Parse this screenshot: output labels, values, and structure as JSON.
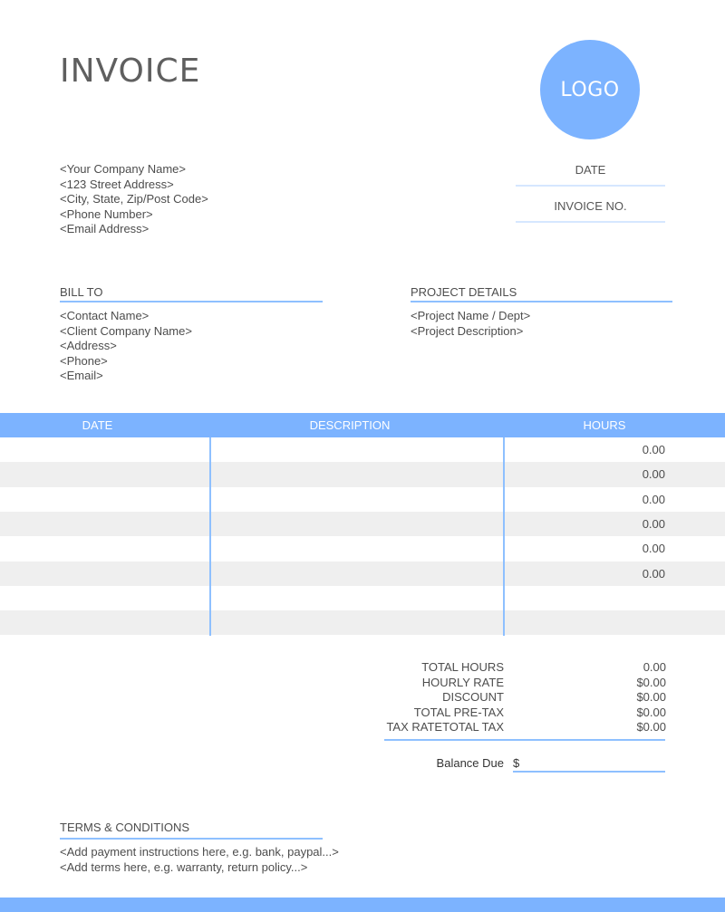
{
  "header": {
    "title": "INVOICE",
    "logo_text": "LOGO"
  },
  "company": {
    "lines": [
      "<Your Company Name>",
      "<123 Street Address>",
      "<City, State, Zip/Post Code>",
      "<Phone Number>",
      "<Email Address>"
    ]
  },
  "meta": {
    "date_label": "DATE",
    "invoice_no_label": "INVOICE NO."
  },
  "bill_to": {
    "heading": "BILL TO",
    "lines": [
      "<Contact Name>",
      "<Client Company Name>",
      "<Address>",
      "<Phone>",
      "<Email>"
    ]
  },
  "project": {
    "heading": "PROJECT DETAILS",
    "lines": [
      "<Project Name / Dept>",
      "<Project Description>"
    ]
  },
  "table": {
    "columns": [
      "DATE",
      "DESCRIPTION",
      "HOURS"
    ],
    "rows": [
      {
        "date": "",
        "description": "",
        "hours": "0.00"
      },
      {
        "date": "",
        "description": "",
        "hours": "0.00"
      },
      {
        "date": "",
        "description": "",
        "hours": "0.00"
      },
      {
        "date": "",
        "description": "",
        "hours": "0.00"
      },
      {
        "date": "",
        "description": "",
        "hours": "0.00"
      },
      {
        "date": "",
        "description": "",
        "hours": "0.00"
      },
      {
        "date": "",
        "description": "",
        "hours": ""
      },
      {
        "date": "",
        "description": "",
        "hours": ""
      }
    ]
  },
  "totals": {
    "labels": [
      "TOTAL HOURS",
      "HOURLY RATE",
      "DISCOUNT",
      "TOTAL PRE-TAX",
      "TAX RATETOTAL TAX"
    ],
    "values": [
      "0.00",
      "$0.00",
      "$0.00",
      "$0.00",
      "$0.00"
    ],
    "balance_label": "Balance Due",
    "balance_currency": "$"
  },
  "terms": {
    "heading": "TERMS & CONDITIONS",
    "lines": [
      "<Add payment instructions here, e.g. bank, paypal...>",
      "<Add terms here, e.g. warranty, return policy...>"
    ]
  },
  "colors": {
    "accent": "#7cb3ff",
    "row_alt": "#efefef",
    "rule": "#8ec0ff"
  }
}
